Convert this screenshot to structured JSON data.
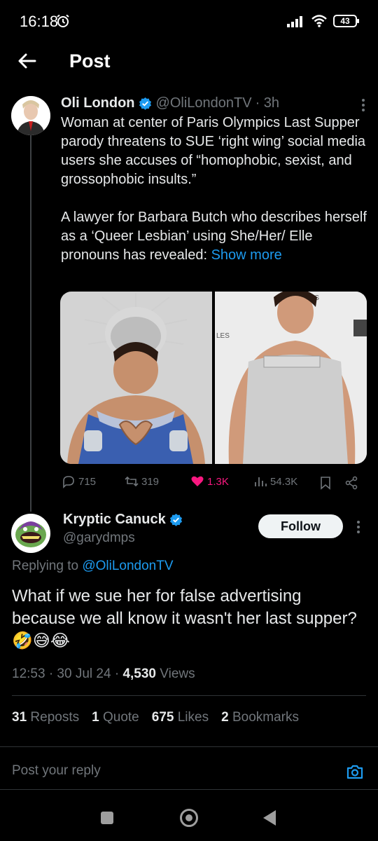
{
  "status_bar": {
    "time": "16:18",
    "battery": "43"
  },
  "header": {
    "title": "Post"
  },
  "original_tweet": {
    "display_name": "Oli London",
    "handle": "@OliLondonTV",
    "time_ago": "· 3h",
    "text_part1": "Woman at center of Paris Olympics Last Supper parody threatens to SUE ‘right wing’ social media users she accuses of “homophobic, sexist, and grossophobic insults.”\n\nA lawyer for Barbara Butch who describes herself as a ‘Queer Lesbian’ using She/Her/ Elle pronouns has revealed: ",
    "show_more": "Show more",
    "actions": {
      "replies": "715",
      "reposts": "319",
      "likes": "1.3K",
      "views": "54.3K"
    }
  },
  "reply_tweet": {
    "display_name": "Kryptic Canuck",
    "handle": "@garydmps",
    "follow_label": "Follow",
    "replying_prefix": "Replying to ",
    "replying_to": "@OliLondonTV",
    "text": "What if we sue her for false advertising because we all know it wasn't her last supper? 🤣😅😂",
    "time": "12:53 · 30 Jul 24 · ",
    "views_count": "4,530",
    "views_label": " Views",
    "stats": {
      "reposts_count": "31",
      "reposts_label": "Reposts",
      "quotes_count": "1",
      "quotes_label": "Quote",
      "likes_count": "675",
      "likes_label": "Likes",
      "bookmarks_count": "2",
      "bookmarks_label": "Bookmarks"
    }
  },
  "composer": {
    "placeholder": "Post your reply"
  },
  "colors": {
    "background": "#000000",
    "accent": "#1d9bf0",
    "like": "#f91880",
    "muted": "#71767b"
  }
}
